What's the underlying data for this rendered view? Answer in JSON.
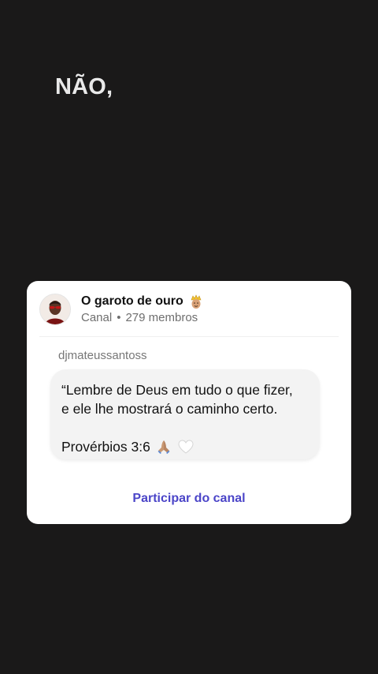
{
  "story": {
    "text": "NÃO,"
  },
  "channel": {
    "name": "O garoto de ouro",
    "type": "Canal",
    "separator": "•",
    "members": "279 membros",
    "name_emoji": "crown-face-icon"
  },
  "message": {
    "author": "djmateussantoss",
    "line1": "“Lembre de Deus em tudo o que fizer,",
    "line2": "e ele lhe mostrará o caminho certo.",
    "reference": "Provérbios 3:6",
    "emojis": [
      "praying-hands-icon",
      "white-heart-icon"
    ]
  },
  "cta": {
    "label": "Participar do canal"
  },
  "colors": {
    "background": "#1a1919",
    "card": "#ffffff",
    "accent": "#4b45c8"
  }
}
